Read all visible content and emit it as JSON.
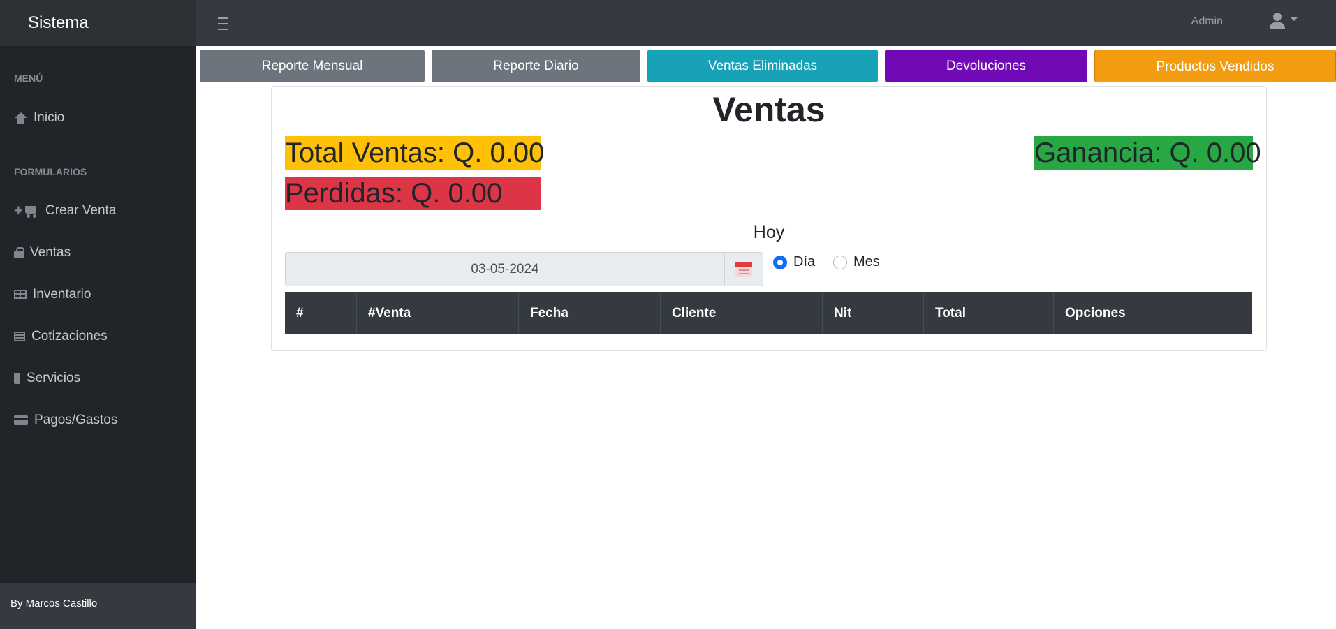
{
  "app": {
    "title": "Sistema",
    "user": "Admin"
  },
  "sidebar": {
    "sections": [
      {
        "heading": "MENÚ",
        "items": [
          {
            "label": "Inicio",
            "icon": "home-icon"
          }
        ]
      },
      {
        "heading": "FORMULARIOS",
        "items": [
          {
            "label": "Crear Venta",
            "icon": "cart-plus-icon"
          },
          {
            "label": "Ventas",
            "icon": "shopping-bag-icon"
          },
          {
            "label": "Inventario",
            "icon": "table-icon"
          },
          {
            "label": "Cotizaciones",
            "icon": "list-icon"
          },
          {
            "label": "Servicios",
            "icon": "mobile-icon"
          },
          {
            "label": "Pagos/Gastos",
            "icon": "credit-card-icon"
          }
        ]
      }
    ],
    "footer": "By Marcos Castillo"
  },
  "top_buttons": [
    {
      "label": "Reporte Mensual",
      "color": "#6c757d"
    },
    {
      "label": "Reporte Diario",
      "color": "#6c757d"
    },
    {
      "label": "Ventas Eliminadas",
      "color": "#17a2b8"
    },
    {
      "label": "Devoluciones",
      "color": "#7209b7"
    },
    {
      "label": "Productos Vendidos",
      "color": "#f39c12"
    }
  ],
  "main": {
    "title": "Ventas",
    "total_ventas": "Total Ventas: Q. 0.00",
    "ganancia": "Ganancia: Q. 0.00",
    "perdidas": "Perdidas: Q. 0.00",
    "period_label": "Hoy",
    "date_value": "03-05-2024",
    "radio_options": [
      {
        "label": "Día",
        "selected": true
      },
      {
        "label": "Mes",
        "selected": false
      }
    ],
    "table": {
      "columns": [
        "#",
        "#Venta",
        "Fecha",
        "Cliente",
        "Nit",
        "Total",
        "Opciones"
      ],
      "rows": []
    }
  },
  "colors": {
    "total_ventas": "#ffc107",
    "ganancia": "#28a745",
    "perdidas": "#dc3545"
  }
}
